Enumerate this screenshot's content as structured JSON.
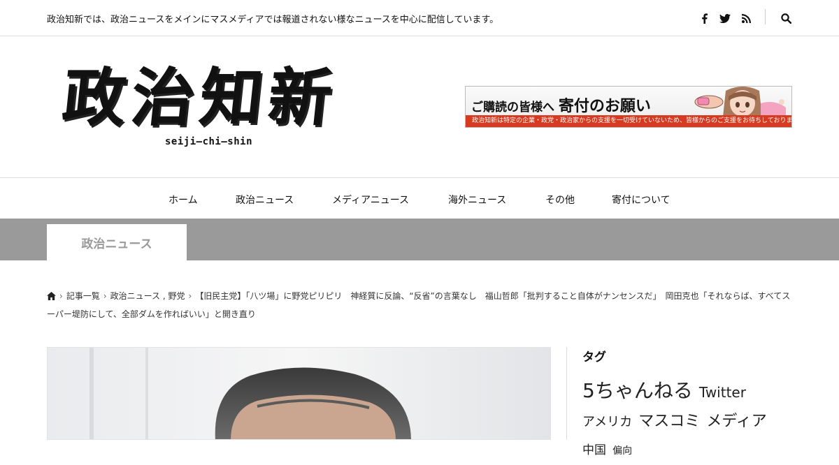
{
  "topbar": {
    "tagline": "政治知新では、政治ニュースをメインにマスメディアでは報道されない様なニュースを中心に配信しています。",
    "icons": [
      "facebook-icon",
      "twitter-icon",
      "rss-icon",
      "search-icon"
    ]
  },
  "logo": {
    "kanji": "政治知新",
    "roman": "seiji–chi–shin"
  },
  "banner": {
    "heading_prefix": "ご購読の皆様へ",
    "heading_main": "寄付のお願い",
    "subtext": "政治知新は特定の企業・政党・政治家からの支援を一切受けていないため、皆様からのご支援をお待ちしております。",
    "accent_color": "#d63a20"
  },
  "nav": {
    "items": [
      "ホーム",
      "政治ニュース",
      "メディアニュース",
      "海外ニュース",
      "その他",
      "寄付について"
    ]
  },
  "category": {
    "label": "政治ニュース",
    "band_color": "#9a9a9a"
  },
  "breadcrumb": {
    "home_icon": "home-icon",
    "items": [
      "記事一覧",
      "政治ニュース , 野党"
    ],
    "current": "【旧民主党】「八ツ場」に野党ピリピリ　神経質に反論、“反省”の言葉なし　福山哲郎「批判すること自体がナンセンスだ」　岡田克也「それならば、すべてスーパー堤防にして、全部ダムを作ればいい」と開き直り"
  },
  "sidebar": {
    "title": "タグ",
    "tags": [
      {
        "label": "5ちゃんねる",
        "size": 28
      },
      {
        "label": "Twitter",
        "size": 20
      },
      {
        "label": "アメリカ",
        "size": 18
      },
      {
        "label": "マスコミ",
        "size": 22
      },
      {
        "label": "メディア",
        "size": 22
      },
      {
        "label": "中国",
        "size": 17
      },
      {
        "label": "偏向",
        "size": 14
      }
    ]
  }
}
